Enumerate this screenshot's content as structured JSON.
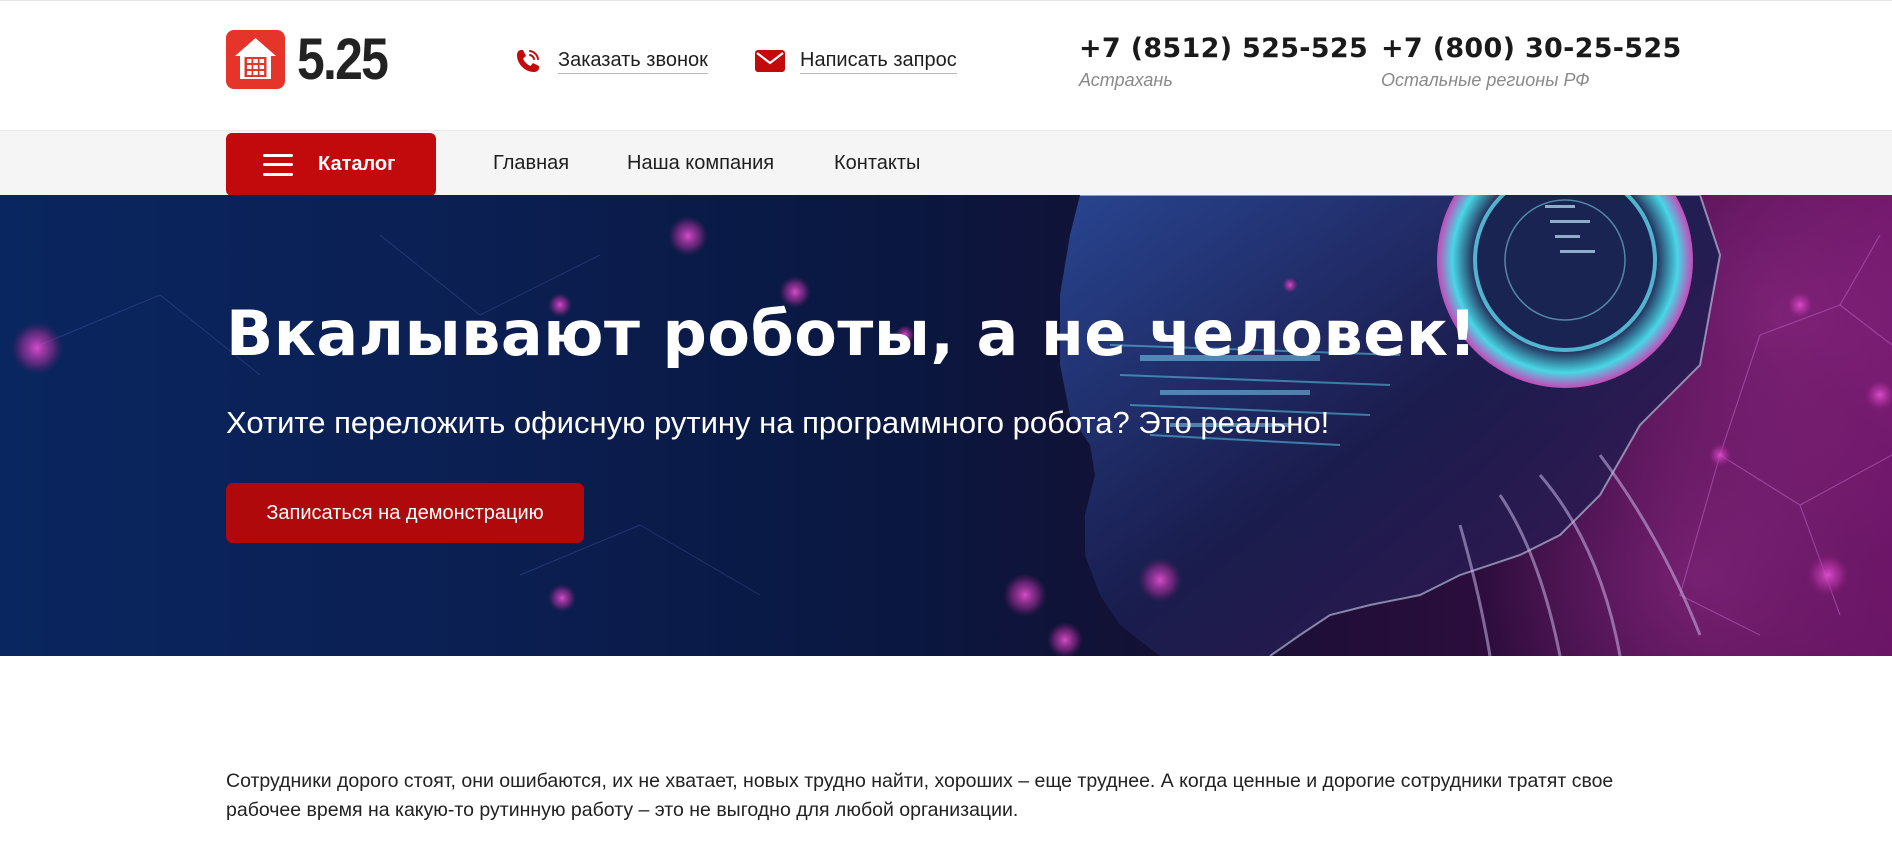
{
  "header": {
    "logo_text": "5.25",
    "callback_label": "Заказать звонок",
    "request_label": "Написать запрос",
    "phones": [
      {
        "number": "+7 (8512) 525-525",
        "region": "Астрахань"
      },
      {
        "number": "+7 (800) 30-25-525",
        "region": "Остальные регионы РФ"
      }
    ]
  },
  "nav": {
    "catalog_label": "Каталог",
    "items": [
      {
        "label": "Главная"
      },
      {
        "label": "Наша компания"
      },
      {
        "label": "Контакты"
      }
    ]
  },
  "hero": {
    "title": "Вкалывают роботы, а не человек!",
    "subtitle": "Хотите переложить офисную рутину на программного робота? Это реально!",
    "button_label": "Записаться на демонстрацию"
  },
  "content": {
    "intro": "Сотрудники дорого стоят, они ошибаются, их не хватает, новых трудно найти, хороших – еще труднее. А когда ценные и дорогие сотрудники тратят свое рабочее время на какую-то рутинную работу – это не выгодно для любой организации."
  },
  "colors": {
    "brand_red": "#c20a0c",
    "logo_red": "#e5342a",
    "hero_navy": "#0b1f52",
    "hero_magenta": "#6a1466"
  },
  "icons": {
    "logo": "house-logo-icon",
    "callback": "phone-icon",
    "request": "envelope-icon",
    "catalog": "hamburger-menu-icon"
  }
}
